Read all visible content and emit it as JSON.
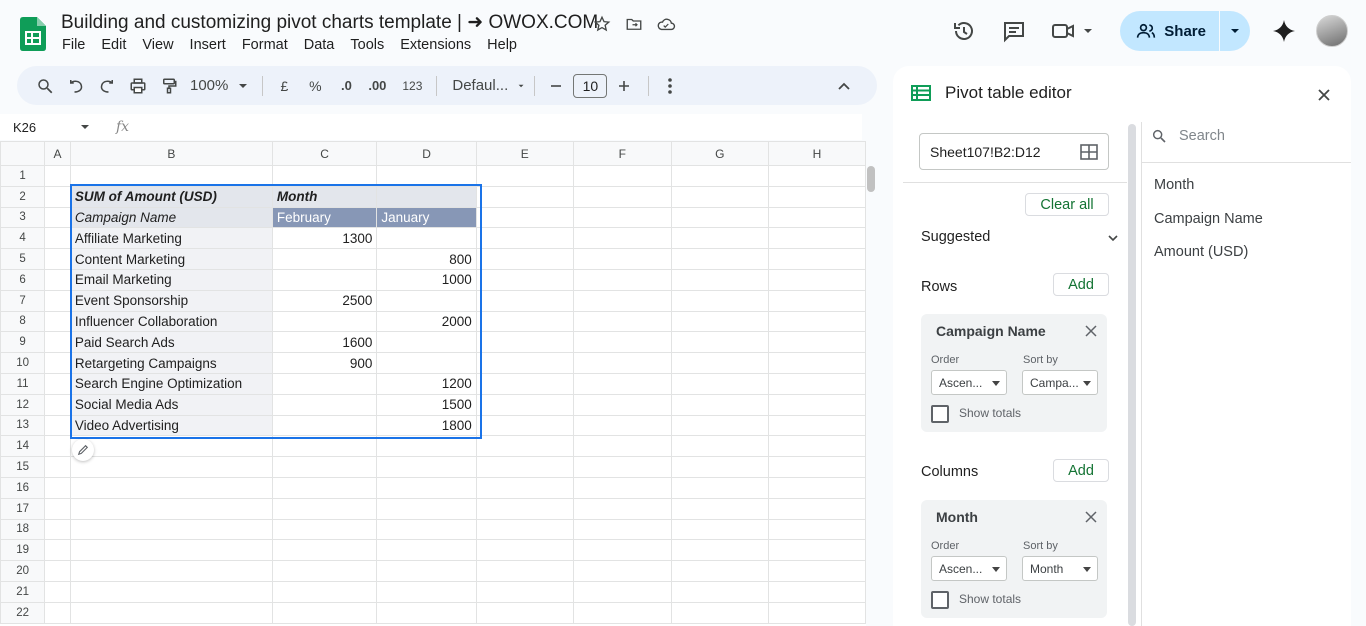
{
  "doc": {
    "title": "Building and customizing pivot charts template | ➜ OWOX.COM",
    "menu": [
      "File",
      "Edit",
      "View",
      "Insert",
      "Format",
      "Data",
      "Tools",
      "Extensions",
      "Help"
    ]
  },
  "header": {
    "share_label": "Share"
  },
  "toolbar": {
    "zoom": "100%",
    "currency": "£",
    "percent": "%",
    "dec_decrease": ".0",
    "dec_increase": ".00",
    "number_format": "123",
    "font": "Defaul...",
    "font_size": "10"
  },
  "formula_bar": {
    "name_box": "K26",
    "fx": "fx",
    "value": ""
  },
  "grid": {
    "columns": [
      "A",
      "B",
      "C",
      "D",
      "E",
      "F",
      "G",
      "H"
    ],
    "rows": [
      {
        "n": "1",
        "b": "",
        "c": "",
        "d": ""
      },
      {
        "n": "2",
        "b": "SUM of Amount (USD)",
        "c": "Month",
        "d": ""
      },
      {
        "n": "3",
        "b": "Campaign Name",
        "c": "February",
        "d": "January"
      },
      {
        "n": "4",
        "b": "Affiliate Marketing",
        "c": "1300",
        "d": ""
      },
      {
        "n": "5",
        "b": "Content Marketing",
        "c": "",
        "d": "800"
      },
      {
        "n": "6",
        "b": "Email Marketing",
        "c": "",
        "d": "1000"
      },
      {
        "n": "7",
        "b": "Event Sponsorship",
        "c": "2500",
        "d": ""
      },
      {
        "n": "8",
        "b": "Influencer Collaboration",
        "c": "",
        "d": "2000"
      },
      {
        "n": "9",
        "b": "Paid Search Ads",
        "c": "1600",
        "d": ""
      },
      {
        "n": "10",
        "b": "Retargeting Campaigns",
        "c": "900",
        "d": ""
      },
      {
        "n": "11",
        "b": "Search Engine Optimization",
        "c": "",
        "d": "1200"
      },
      {
        "n": "12",
        "b": "Social Media Ads",
        "c": "",
        "d": "1500"
      },
      {
        "n": "13",
        "b": "Video Advertising",
        "c": "",
        "d": "1800"
      },
      {
        "n": "14",
        "b": "",
        "c": "",
        "d": ""
      },
      {
        "n": "15",
        "b": "",
        "c": "",
        "d": ""
      },
      {
        "n": "16",
        "b": "",
        "c": "",
        "d": ""
      },
      {
        "n": "17",
        "b": "",
        "c": "",
        "d": ""
      },
      {
        "n": "18",
        "b": "",
        "c": "",
        "d": ""
      },
      {
        "n": "19",
        "b": "",
        "c": "",
        "d": ""
      },
      {
        "n": "20",
        "b": "",
        "c": "",
        "d": ""
      },
      {
        "n": "21",
        "b": "",
        "c": "",
        "d": ""
      },
      {
        "n": "22",
        "b": "",
        "c": "",
        "d": ""
      }
    ]
  },
  "pivot_editor": {
    "title": "Pivot table editor",
    "range": "Sheet107!B2:D12",
    "clear_all": "Clear all",
    "suggested": "Suggested",
    "rows_label": "Rows",
    "columns_label": "Columns",
    "add_label": "Add",
    "rows_card": {
      "title": "Campaign Name",
      "order_label": "Order",
      "order_value": "Ascen...",
      "sort_label": "Sort by",
      "sort_value": "Campa...",
      "show_totals": "Show totals"
    },
    "columns_card": {
      "title": "Month",
      "order_label": "Order",
      "order_value": "Ascen...",
      "sort_label": "Sort by",
      "sort_value": "Month",
      "show_totals": "Show totals"
    },
    "search_placeholder": "Search",
    "fields": [
      "Month",
      "Campaign Name",
      "Amount (USD)"
    ]
  },
  "colors": {
    "accent": "#1a73e8",
    "sheets_green": "#0f9d58",
    "pivot_header": "#8797b6",
    "add_text": "#137333",
    "share_bg": "#c2e7ff"
  }
}
